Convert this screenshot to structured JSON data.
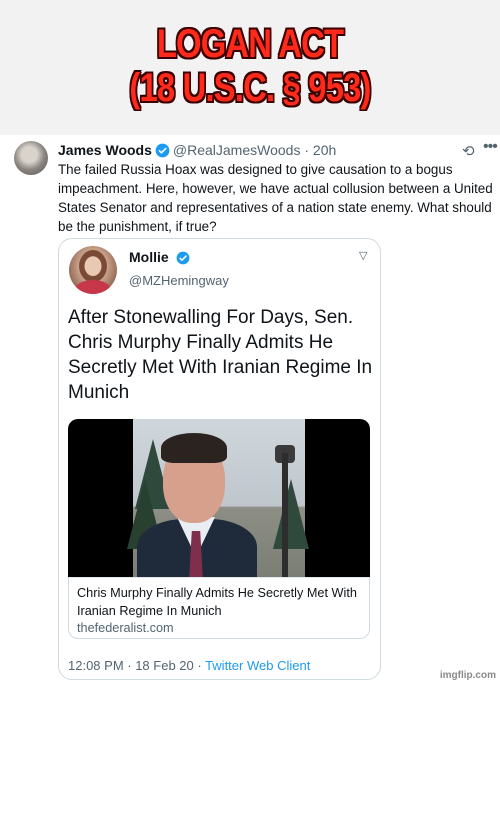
{
  "meme": {
    "title_line1": "LOGAN ACT",
    "title_line2": "(18 U.S.C. § 953)"
  },
  "tweet": {
    "author_name": "James Woods",
    "handle": "@RealJamesWoods",
    "separator": "·",
    "time": "20h",
    "text": "The failed Russia Hoax was designed to give causation to a bogus impeachment. Here, however, we have actual collusion between a United States Senator and representatives of a nation state enemy. What should be the punishment, if true?"
  },
  "quote": {
    "author_name": "Mollie",
    "handle": "@MZHemingway",
    "headline": "After Stonewalling For Days, Sen. Chris Murphy Finally Admits He Secretly Met With Iranian Regime In Munich",
    "link_title": "Chris Murphy Finally Admits He Secretly Met With Iranian Regime In Munich",
    "link_domain": "thefederalist.com",
    "timestamp": "12:08 PM · 18 Feb 20 · ",
    "client": "Twitter Web Client"
  },
  "watermark": "imgflip.com",
  "icons": {
    "verified": "verified-badge-icon",
    "sync": "sync-icon",
    "more": "more-options-icon",
    "chevron": "chevron-down-icon"
  },
  "colors": {
    "title_red": "#ff2a1a",
    "twitter_blue": "#1d9bf0",
    "secondary_text": "#536471"
  }
}
